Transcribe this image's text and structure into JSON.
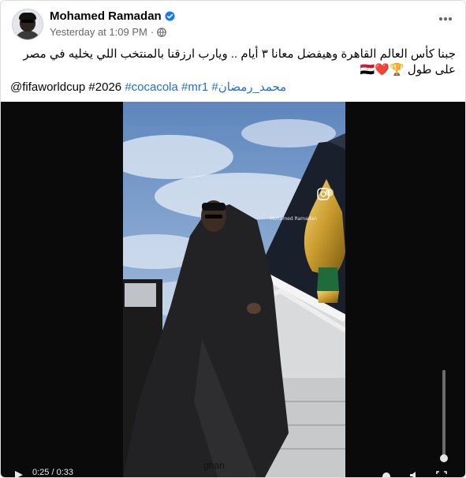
{
  "post": {
    "author": "Mohamed Ramadan",
    "timestamp": "Yesterday at 1:09 PM",
    "separator": "·",
    "text": "جبنا كأس العالم القاهرة وهيفضل معانا ٣ أيام .. ويارب ارزقنا بالمنتخب اللي يخليه في مصر على طول 🏆❤️🇪🇬",
    "hashtags_plain": "@fifaworldcup #2026 ",
    "hashtags_links": [
      "#cocacola",
      "#mr1",
      "#محمد_رمضان"
    ]
  },
  "video": {
    "watermark": "Mohamed Ramadan",
    "caption_partial": "ghan",
    "time_display": "0:25 / 0:33"
  },
  "icons": [
    "verified-badge-icon",
    "globe-icon",
    "more-options-icon",
    "play-icon",
    "settings-icon",
    "volume-icon",
    "fullscreen-icon",
    "instagram-icon"
  ],
  "colors": {
    "link": "#216fdb",
    "verified": "#1877f2",
    "meta": "#65676b",
    "sky": "#7fa3cf"
  }
}
